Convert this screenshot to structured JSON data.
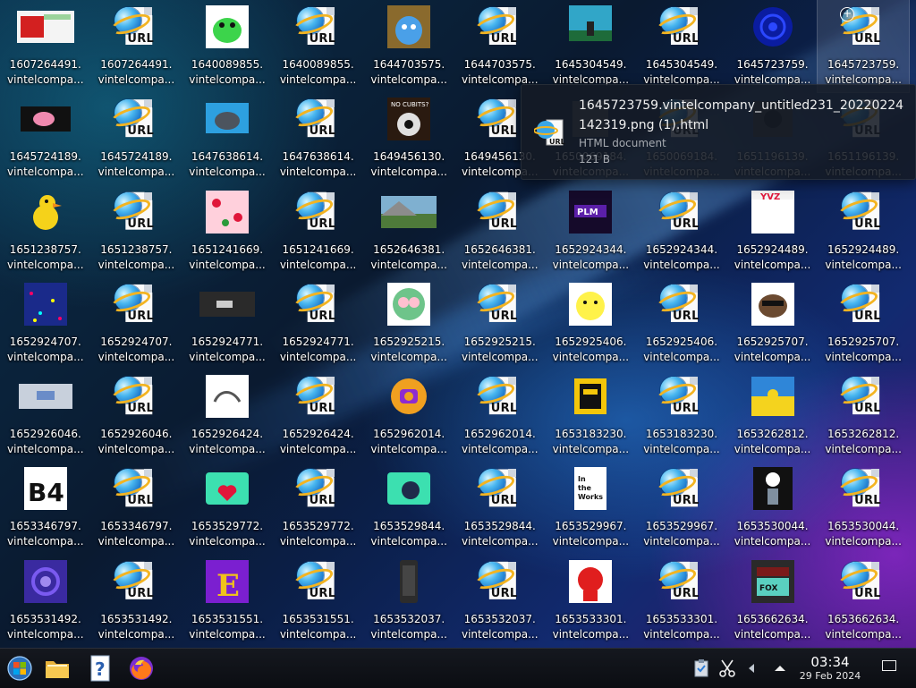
{
  "desktop": {
    "icons": [
      {
        "top": "1607264491.",
        "bottom": "vintelcompa...",
        "type": "image",
        "art": "red-sign"
      },
      {
        "top": "1607264491.",
        "bottom": "vintelcompa...",
        "type": "url"
      },
      {
        "top": "1640089855.",
        "bottom": "vintelcompa...",
        "type": "image",
        "art": "green-frog"
      },
      {
        "top": "1640089855.",
        "bottom": "vintelcompa...",
        "type": "url"
      },
      {
        "top": "1644703575.",
        "bottom": "vintelcompa...",
        "type": "image",
        "art": "blue-cat"
      },
      {
        "top": "1644703575.",
        "bottom": "vintelcompa...",
        "type": "url"
      },
      {
        "top": "1645304549.",
        "bottom": "vintelcompa...",
        "type": "image",
        "art": "sky-scene"
      },
      {
        "top": "1645304549.",
        "bottom": "vintelcompa...",
        "type": "url"
      },
      {
        "top": "1645723759.",
        "bottom": "vintelcompa...",
        "type": "image",
        "art": "blue-circle"
      },
      {
        "top": "1645723759.",
        "bottom": "vintelcompa...",
        "type": "url",
        "hover": true
      },
      {
        "top": "1645724189.",
        "bottom": "vintelcompa...",
        "type": "image",
        "art": "pink-pig"
      },
      {
        "top": "1645724189.",
        "bottom": "vintelcompa...",
        "type": "url"
      },
      {
        "top": "1647638614.",
        "bottom": "vintelcompa...",
        "type": "image",
        "art": "grey-cat"
      },
      {
        "top": "1647638614.",
        "bottom": "vintelcompa...",
        "type": "url"
      },
      {
        "top": "1649456130.",
        "bottom": "vintelcompa...",
        "type": "image",
        "art": "no-cubits"
      },
      {
        "top": "1649456130.",
        "bottom": "vintelcompa...",
        "type": "url"
      },
      {
        "top": "1650069184.",
        "bottom": "vintelcompa...",
        "type": "image",
        "art": "hidden"
      },
      {
        "top": "1650069184.",
        "bottom": "vintelcompa...",
        "type": "url"
      },
      {
        "top": "1651196139.",
        "bottom": "vintelcompa...",
        "type": "image",
        "art": "dark-robot"
      },
      {
        "top": "1651196139.",
        "bottom": "vintelcompa...",
        "type": "url"
      },
      {
        "top": "1651238757.",
        "bottom": "vintelcompa...",
        "type": "image",
        "art": "yellow-duck"
      },
      {
        "top": "1651238757.",
        "bottom": "vintelcompa...",
        "type": "url"
      },
      {
        "top": "1651241669.",
        "bottom": "vintelcompa...",
        "type": "image",
        "art": "hearts"
      },
      {
        "top": "1651241669.",
        "bottom": "vintelcompa...",
        "type": "url"
      },
      {
        "top": "1652646381.",
        "bottom": "vintelcompa...",
        "type": "image",
        "art": "landscape"
      },
      {
        "top": "1652646381.",
        "bottom": "vintelcompa...",
        "type": "url"
      },
      {
        "top": "1652924344.",
        "bottom": "vintelcompa...",
        "type": "image",
        "art": "purple-plm"
      },
      {
        "top": "1652924344.",
        "bottom": "vintelcompa...",
        "type": "url"
      },
      {
        "top": "1652924489.",
        "bottom": "vintelcompa...",
        "type": "image",
        "art": "yvz"
      },
      {
        "top": "1652924489.",
        "bottom": "vintelcompa...",
        "type": "url"
      },
      {
        "top": "1652924707.",
        "bottom": "vintelcompa...",
        "type": "image",
        "art": "confetti"
      },
      {
        "top": "1652924707.",
        "bottom": "vintelcompa...",
        "type": "url"
      },
      {
        "top": "1652924771.",
        "bottom": "vintelcompa...",
        "type": "image",
        "art": "dark-screen"
      },
      {
        "top": "1652924771.",
        "bottom": "vintelcompa...",
        "type": "url"
      },
      {
        "top": "1652925215.",
        "bottom": "vintelcompa...",
        "type": "image",
        "art": "green-owl"
      },
      {
        "top": "1652925215.",
        "bottom": "vintelcompa...",
        "type": "url"
      },
      {
        "top": "1652925406.",
        "bottom": "vintelcompa...",
        "type": "image",
        "art": "pikachu"
      },
      {
        "top": "1652925406.",
        "bottom": "vintelcompa...",
        "type": "url"
      },
      {
        "top": "1652925707.",
        "bottom": "vintelcompa...",
        "type": "image",
        "art": "raccoon"
      },
      {
        "top": "1652925707.",
        "bottom": "vintelcompa...",
        "type": "url"
      },
      {
        "top": "1652926046.",
        "bottom": "vintelcompa...",
        "type": "image",
        "art": "blurry"
      },
      {
        "top": "1652926046.",
        "bottom": "vintelcompa...",
        "type": "url"
      },
      {
        "top": "1652926424.",
        "bottom": "vintelcompa...",
        "type": "image",
        "art": "sketch"
      },
      {
        "top": "1652926424.",
        "bottom": "vintelcompa...",
        "type": "url"
      },
      {
        "top": "1652962014.",
        "bottom": "vintelcompa...",
        "type": "image",
        "art": "orange-ring"
      },
      {
        "top": "1652962014.",
        "bottom": "vintelcompa...",
        "type": "url"
      },
      {
        "top": "1653183230.",
        "bottom": "vintelcompa...",
        "type": "image",
        "art": "yellow-block"
      },
      {
        "top": "1653183230.",
        "bottom": "vintelcompa...",
        "type": "url"
      },
      {
        "top": "1653262812.",
        "bottom": "vintelcompa...",
        "type": "image",
        "art": "flag"
      },
      {
        "top": "1653262812.",
        "bottom": "vintelcompa...",
        "type": "url"
      },
      {
        "top": "1653346797.",
        "bottom": "vintelcompa...",
        "type": "image",
        "art": "b4"
      },
      {
        "top": "1653346797.",
        "bottom": "vintelcompa...",
        "type": "url"
      },
      {
        "top": "1653529772.",
        "bottom": "vintelcompa...",
        "type": "image",
        "art": "teal-heart"
      },
      {
        "top": "1653529772.",
        "bottom": "vintelcompa...",
        "type": "url"
      },
      {
        "top": "1653529844.",
        "bottom": "vintelcompa...",
        "type": "image",
        "art": "teal-camera"
      },
      {
        "top": "1653529844.",
        "bottom": "vintelcompa...",
        "type": "url"
      },
      {
        "top": "1653529967.",
        "bottom": "vintelcompa...",
        "type": "image",
        "art": "in-the-works"
      },
      {
        "top": "1653529967.",
        "bottom": "vintelcompa...",
        "type": "url"
      },
      {
        "top": "1653530044.",
        "bottom": "vintelcompa...",
        "type": "image",
        "art": "character"
      },
      {
        "top": "1653530044.",
        "bottom": "vintelcompa...",
        "type": "url"
      },
      {
        "top": "1653531492.",
        "bottom": "vintelcompa...",
        "type": "image",
        "art": "blue-swirl"
      },
      {
        "top": "1653531492.",
        "bottom": "vintelcompa...",
        "type": "url"
      },
      {
        "top": "1653531551.",
        "bottom": "vintelcompa...",
        "type": "image",
        "art": "letter-e"
      },
      {
        "top": "1653531551.",
        "bottom": "vintelcompa...",
        "type": "url"
      },
      {
        "top": "1653532037.",
        "bottom": "vintelcompa...",
        "type": "image",
        "art": "phone"
      },
      {
        "top": "1653532037.",
        "bottom": "vintelcompa...",
        "type": "url"
      },
      {
        "top": "1653533301.",
        "bottom": "vintelcompa...",
        "type": "image",
        "art": "red-mascot"
      },
      {
        "top": "1653533301.",
        "bottom": "vintelcompa...",
        "type": "url"
      },
      {
        "top": "1653662634.",
        "bottom": "vintelcompa...",
        "type": "image",
        "art": "fox-logo"
      },
      {
        "top": "1653662634.",
        "bottom": "vintelcompa...",
        "type": "url"
      }
    ]
  },
  "tooltip": {
    "title": "1645723759.vintelcompany_untitled231_20220224142319.png (1).html",
    "type": "HTML document",
    "size": "121 B"
  },
  "taskbar": {
    "time": "03:34",
    "date": "29 Feb 2024"
  },
  "colors": {
    "taskbar_bg": "#0f1218",
    "tooltip_bg": "#141a24",
    "url_ring": "#f3b421",
    "globe": "#48b6ef"
  }
}
